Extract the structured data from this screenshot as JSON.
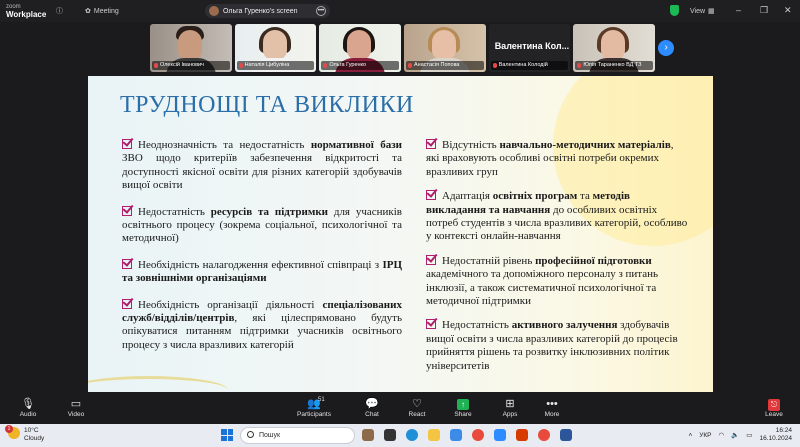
{
  "titlebar": {
    "logo_line1": "zoom",
    "logo_line2": "Workplace",
    "meeting_label": "Meeting",
    "share_label": "Ольга Гуренко's screen",
    "view_label": "View"
  },
  "participants": [
    {
      "name": "Олексій Іванович",
      "style": "man"
    },
    {
      "name": "Наталія Цибуліна",
      "style": "curly"
    },
    {
      "name": "Ольга Гуренко",
      "style": "dark",
      "active": true
    },
    {
      "name": "Анастасія Попова",
      "style": "blonde"
    },
    {
      "name": "Валентина Колодій",
      "display": "Валентина  Кол...",
      "style": "text"
    },
    {
      "name": "Юлія Тараненко ВД ТЗ",
      "style": "brown"
    }
  ],
  "slide": {
    "title": "ТРУДНОЩІ ТА ВИКЛИКИ",
    "left": [
      [
        {
          "t": "Неоднозначність та недостатність "
        },
        {
          "t": "нормативної бази",
          "b": true
        },
        {
          "t": " ЗВО щодо критеріїв забезпечення відкритості та доступності якісної освіти для різних категорій здобувачів вищої освіти"
        }
      ],
      [
        {
          "t": "Недостатність "
        },
        {
          "t": "ресурсів та підтримки",
          "b": true
        },
        {
          "t": " для учасників освітнього процесу (зокрема соціальної, психологічної та методичної)"
        }
      ],
      [
        {
          "t": "Необхідність налагодження ефективної співпраці з "
        },
        {
          "t": "ІРЦ та зовнішніми організаціями",
          "b": true
        }
      ],
      [
        {
          "t": "Необхідність організації діяльності "
        },
        {
          "t": "спеціалізованих служб/відділів/центрів",
          "b": true
        },
        {
          "t": ", які цілеспрямовано будуть опікуватися питанням підтримки учасників освітнього процесу з числа вразливих категорій"
        }
      ]
    ],
    "right": [
      [
        {
          "t": "Відсутність "
        },
        {
          "t": "навчально-методичних матеріалів",
          "b": true
        },
        {
          "t": ", які враховують особливі освітні потреби окремих вразливих груп"
        }
      ],
      [
        {
          "t": "Адаптація "
        },
        {
          "t": "освітніх програм",
          "b": true
        },
        {
          "t": " та "
        },
        {
          "t": "методів викладання та навчання",
          "b": true
        },
        {
          "t": " до особливих освітніх потреб студентів з числа вразливих категорій, особливо у контексті онлайн-навчання"
        }
      ],
      [
        {
          "t": "Недостатній рівень "
        },
        {
          "t": "професійної підготовки",
          "b": true
        },
        {
          "t": " академічного та допоміжного персоналу з питань інклюзії,  а також систематичної психологічної та методичної підтримки"
        }
      ],
      [
        {
          "t": "Недостатність "
        },
        {
          "t": "активного залучення",
          "b": true
        },
        {
          "t": " здобувачів вищої освіти з числа вразливих категорій до процесів прийняття рішень та розвитку інклюзивних політик університетів"
        }
      ]
    ]
  },
  "controls": {
    "audio": "Audio",
    "video": "Video",
    "participants": "Participants",
    "participants_count": "51",
    "chat": "Chat",
    "react": "React",
    "share": "Share",
    "apps": "Apps",
    "more": "More",
    "leave": "Leave"
  },
  "taskbar": {
    "weather_temp": "10°C",
    "weather_desc": "Cloudy",
    "notification_count": "1",
    "search_placeholder": "Пошук",
    "lang": "УКР",
    "time": "16:24",
    "date": "16.10.2024"
  },
  "colors": {
    "accent_title": "#2b6ea8",
    "check": "#b01e6e",
    "zoom_blue": "#2d8cff",
    "active_border": "#3ddc84"
  }
}
